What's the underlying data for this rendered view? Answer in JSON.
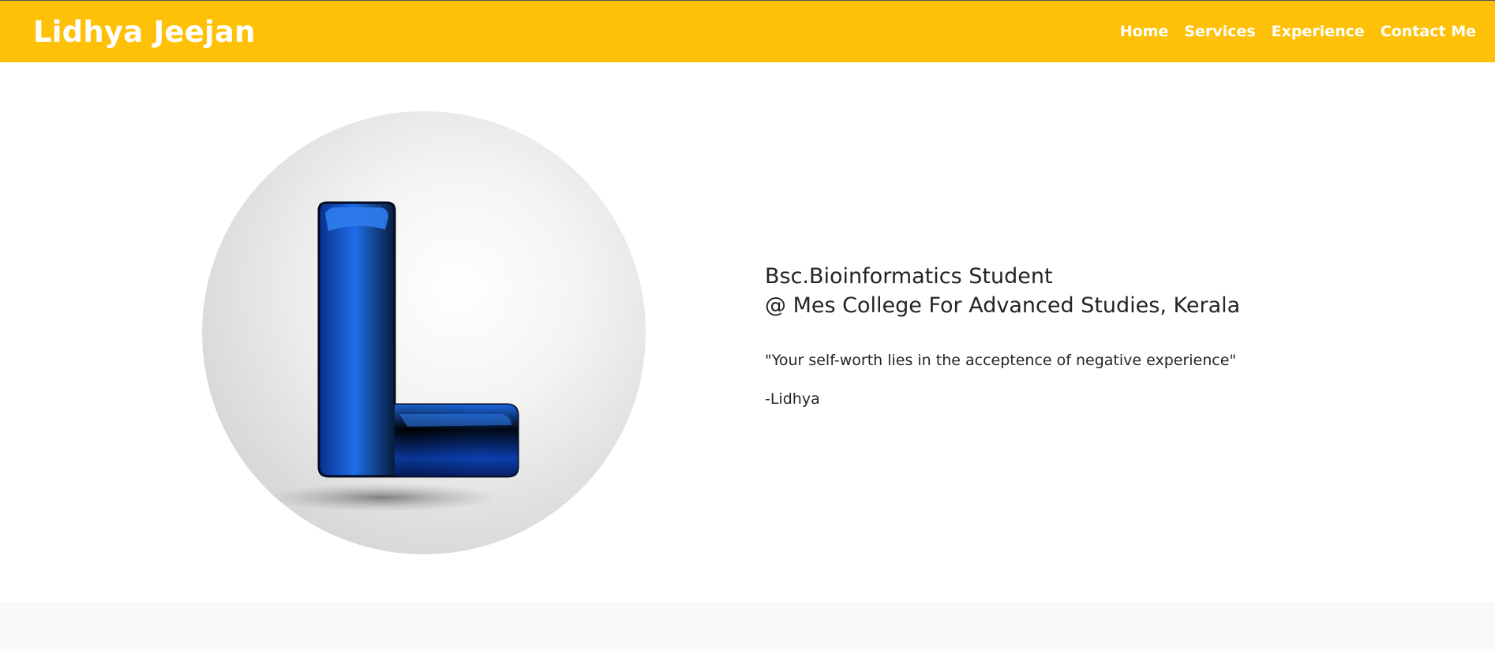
{
  "brand": "Lidhya Jeejan",
  "nav": {
    "items": [
      "Home",
      "Services",
      "Experience",
      "Contact Me"
    ]
  },
  "hero": {
    "avatar_icon": "letter-l-logo",
    "headline_line1": "Bsc.Bioinformatics Student",
    "headline_line2": "@ Mes College For Advanced Studies, Kerala",
    "quote": "\"Your self-worth lies in the acceptence of negative experience\"",
    "signature": "-Lidhya"
  },
  "colors": {
    "navbar": "#ffc107",
    "accent_blue": "#1565c0",
    "footer_band": "#f8f9fa"
  }
}
